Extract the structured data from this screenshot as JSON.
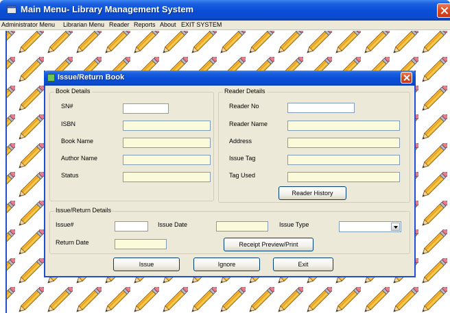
{
  "main_window": {
    "title": "Main Menu- Library Management System"
  },
  "menubar": {
    "items": [
      "Administrator Menu",
      "Librarian Menu",
      "Reader",
      "Reports",
      "About",
      "EXIT SYSTEM"
    ]
  },
  "dialog": {
    "title": "Issue/Return Book",
    "book_details": {
      "legend": "Book Details",
      "sn_label": "SN#",
      "isbn_label": "ISBN",
      "book_name_label": "Book Name",
      "author_name_label": "Author Name",
      "status_label": "Status"
    },
    "reader_details": {
      "legend": "Reader Details",
      "reader_no_label": "Reader No",
      "reader_name_label": "Reader Name",
      "address_label": "Address",
      "issue_tag_label": "Issue Tag",
      "tag_used_label": "Tag Used",
      "reader_history_button": "Reader History"
    },
    "issue_return_details": {
      "legend": "Issue/Return Details",
      "issue_no_label": "Issue#",
      "issue_date_label": "Issue Date",
      "issue_type_label": "Issue Type",
      "return_date_label": "Return Date",
      "receipt_button": "Receipt Preview/Print"
    },
    "buttons": {
      "issue": "Issue",
      "ignore": "Ignore",
      "exit": "Exit"
    }
  },
  "colors": {
    "titlebar_blue": "#0a4fd8",
    "dialog_bg": "#ece9d8",
    "readonly_field": "#fbfbdc",
    "close_red": "#d94a22"
  },
  "icons": {
    "background_pattern": "pencil-icon",
    "main_close": "close-icon",
    "dialog_close": "close-icon",
    "combo": "chevron-down-icon"
  }
}
